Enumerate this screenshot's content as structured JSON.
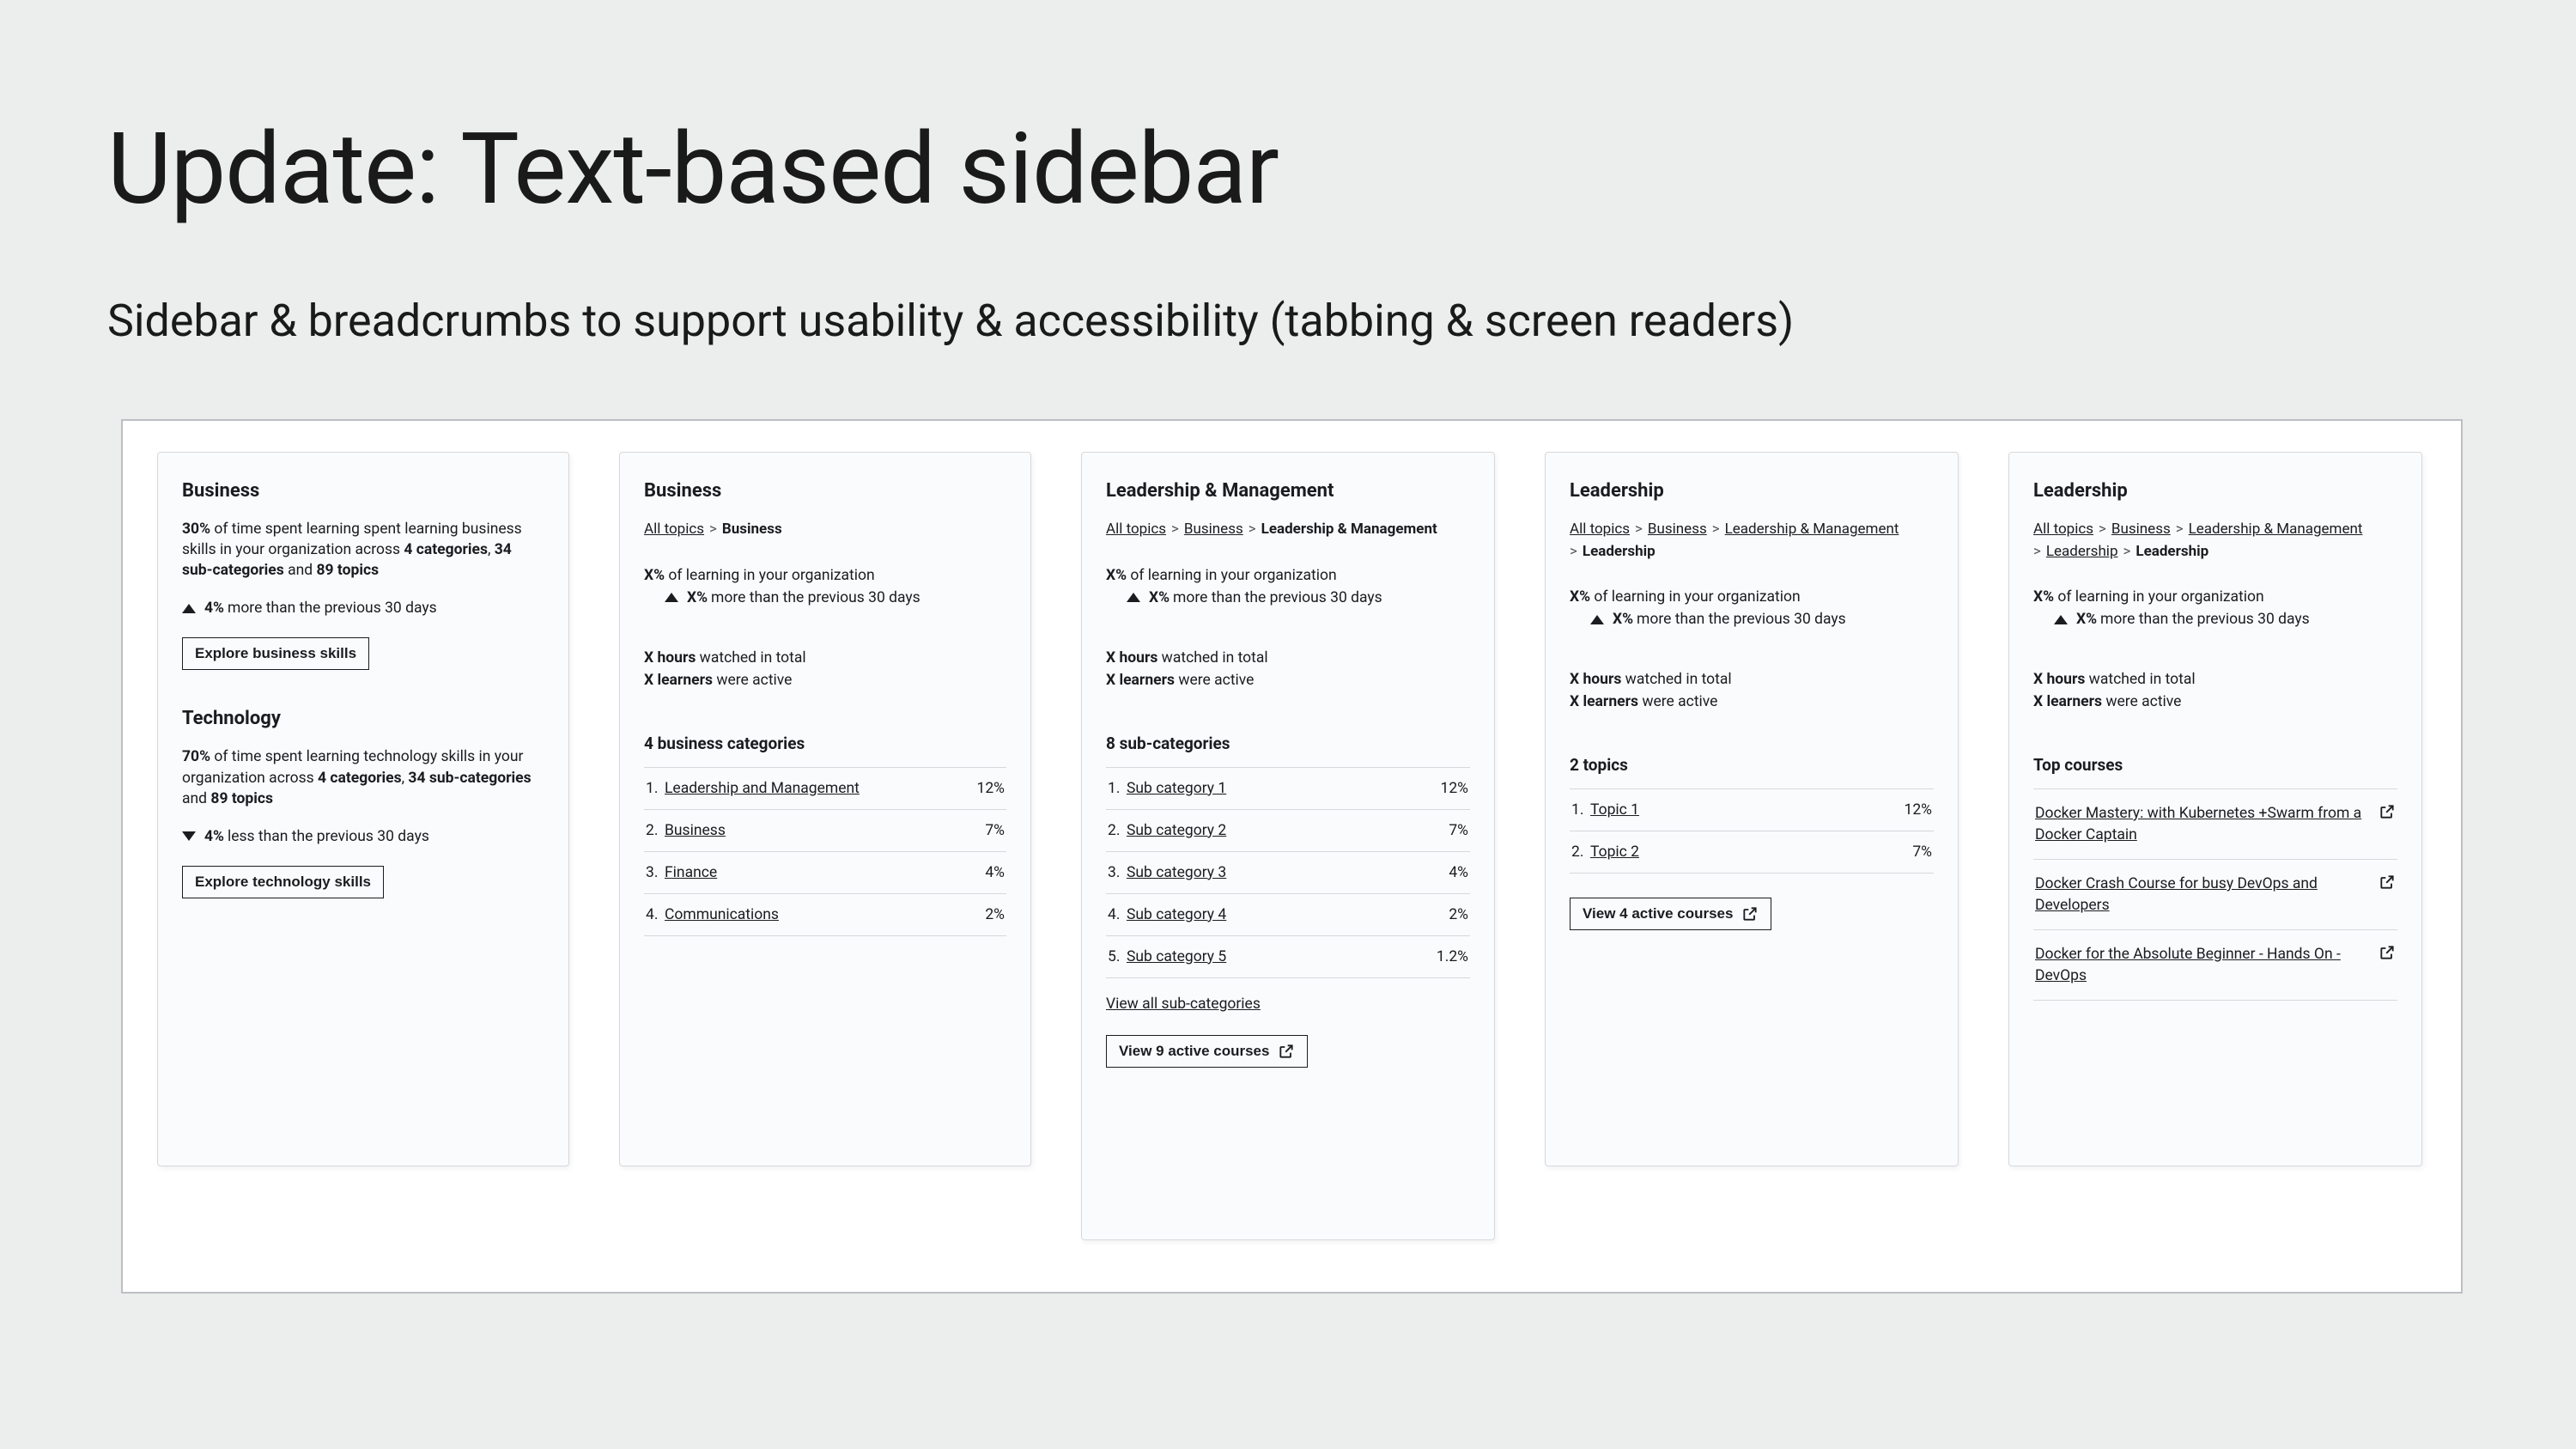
{
  "title": "Update: Text-based sidebar",
  "subtitle": "Sidebar & breadcrumbs to support usability & accessibility (tabbing & screen readers)",
  "panel1": {
    "business": {
      "heading": "Business",
      "pct": "30%",
      "text1": " of time spent learning spent learning business skills in your organization across ",
      "bold1": "4 categories",
      "sep1": ", ",
      "bold2": "34 sub-categories",
      "sep2": " and ",
      "bold3": "89 topics",
      "delta_pct": "4%",
      "delta_text": " more than the previous 30 days",
      "button": "Explore business skills"
    },
    "technology": {
      "heading": "Technology",
      "pct": "70%",
      "text1": " of time spent learning technology skills in your organization across ",
      "bold1": "4 categories",
      "sep1": ", ",
      "bold2": "34 sub-categories",
      "sep2": " and ",
      "bold3": "89 topics",
      "delta_pct": "4%",
      "delta_text": " less than the previous 30 days",
      "button": "Explore technology skills"
    }
  },
  "panel2": {
    "heading": "Business",
    "crumb_all": "All topics",
    "crumb_current": "Business",
    "org_pct": "X%",
    "org_text": " of learning in your organization",
    "delta_pct": "X%",
    "delta_text": " more than the previous 30 days",
    "hours_bold": "X hours",
    "hours_text": " watched in total",
    "learners_bold": "X learners",
    "learners_text": " were active",
    "list_heading": "4 business categories",
    "rows": [
      {
        "n": "1.",
        "label": "Leadership and Management",
        "pct": "12%"
      },
      {
        "n": "2.",
        "label": "Business",
        "pct": "7%"
      },
      {
        "n": "3.",
        "label": "Finance",
        "pct": "4%"
      },
      {
        "n": "4.",
        "label": "Communications",
        "pct": "2%"
      }
    ]
  },
  "panel3": {
    "heading": "Leadership & Management",
    "crumb_all": "All topics",
    "crumb_link1": "Business",
    "crumb_current": "Leadership & Management",
    "org_pct": "X%",
    "org_text": " of learning in your organization",
    "delta_pct": "X%",
    "delta_text": " more than the previous 30 days",
    "hours_bold": "X hours",
    "hours_text": " watched in total",
    "learners_bold": "X learners",
    "learners_text": " were active",
    "list_heading": "8 sub-categories",
    "rows": [
      {
        "n": "1.",
        "label": "Sub category 1",
        "pct": "12%"
      },
      {
        "n": "2.",
        "label": "Sub category 2",
        "pct": "7%"
      },
      {
        "n": "3.",
        "label": "Sub category 3",
        "pct": "4%"
      },
      {
        "n": "4.",
        "label": "Sub category 4",
        "pct": "2%"
      },
      {
        "n": "5.",
        "label": "Sub category 5",
        "pct": "1.2%"
      }
    ],
    "view_all": "View all sub-categories",
    "button": "View 9 active courses"
  },
  "panel4": {
    "heading": "Leadership",
    "crumb_all": "All topics",
    "crumb_link1": "Business",
    "crumb_link2": "Leadership & Management",
    "crumb_current": "Leadership",
    "org_pct": "X%",
    "org_text": " of learning in your organization",
    "delta_pct": "X%",
    "delta_text": " more than the previous 30 days",
    "hours_bold": "X hours",
    "hours_text": " watched in total",
    "learners_bold": "X learners",
    "learners_text": " were active",
    "list_heading": "2 topics",
    "rows": [
      {
        "n": "1.",
        "label": "Topic 1",
        "pct": "12%"
      },
      {
        "n": "2.",
        "label": "Topic 2",
        "pct": "7%"
      }
    ],
    "button": "View 4 active courses"
  },
  "panel5": {
    "heading": "Leadership",
    "crumb_all": "All topics",
    "crumb_link1": "Business",
    "crumb_link2": "Leadership & Management",
    "crumb_link3": "Leadership",
    "crumb_current": "Leadership",
    "org_pct": "X%",
    "org_text": " of learning in your organization",
    "delta_pct": "X%",
    "delta_text": " more than the previous 30 days",
    "hours_bold": "X hours",
    "hours_text": " watched in total",
    "learners_bold": "X learners",
    "learners_text": " were active",
    "list_heading": "Top courses",
    "courses": [
      "Docker Mastery: with Kubernetes +Swarm from a Docker Captain",
      "Docker Crash Course for busy DevOps and Developers",
      "Docker for the Absolute Beginner - Hands On - DevOps"
    ]
  }
}
